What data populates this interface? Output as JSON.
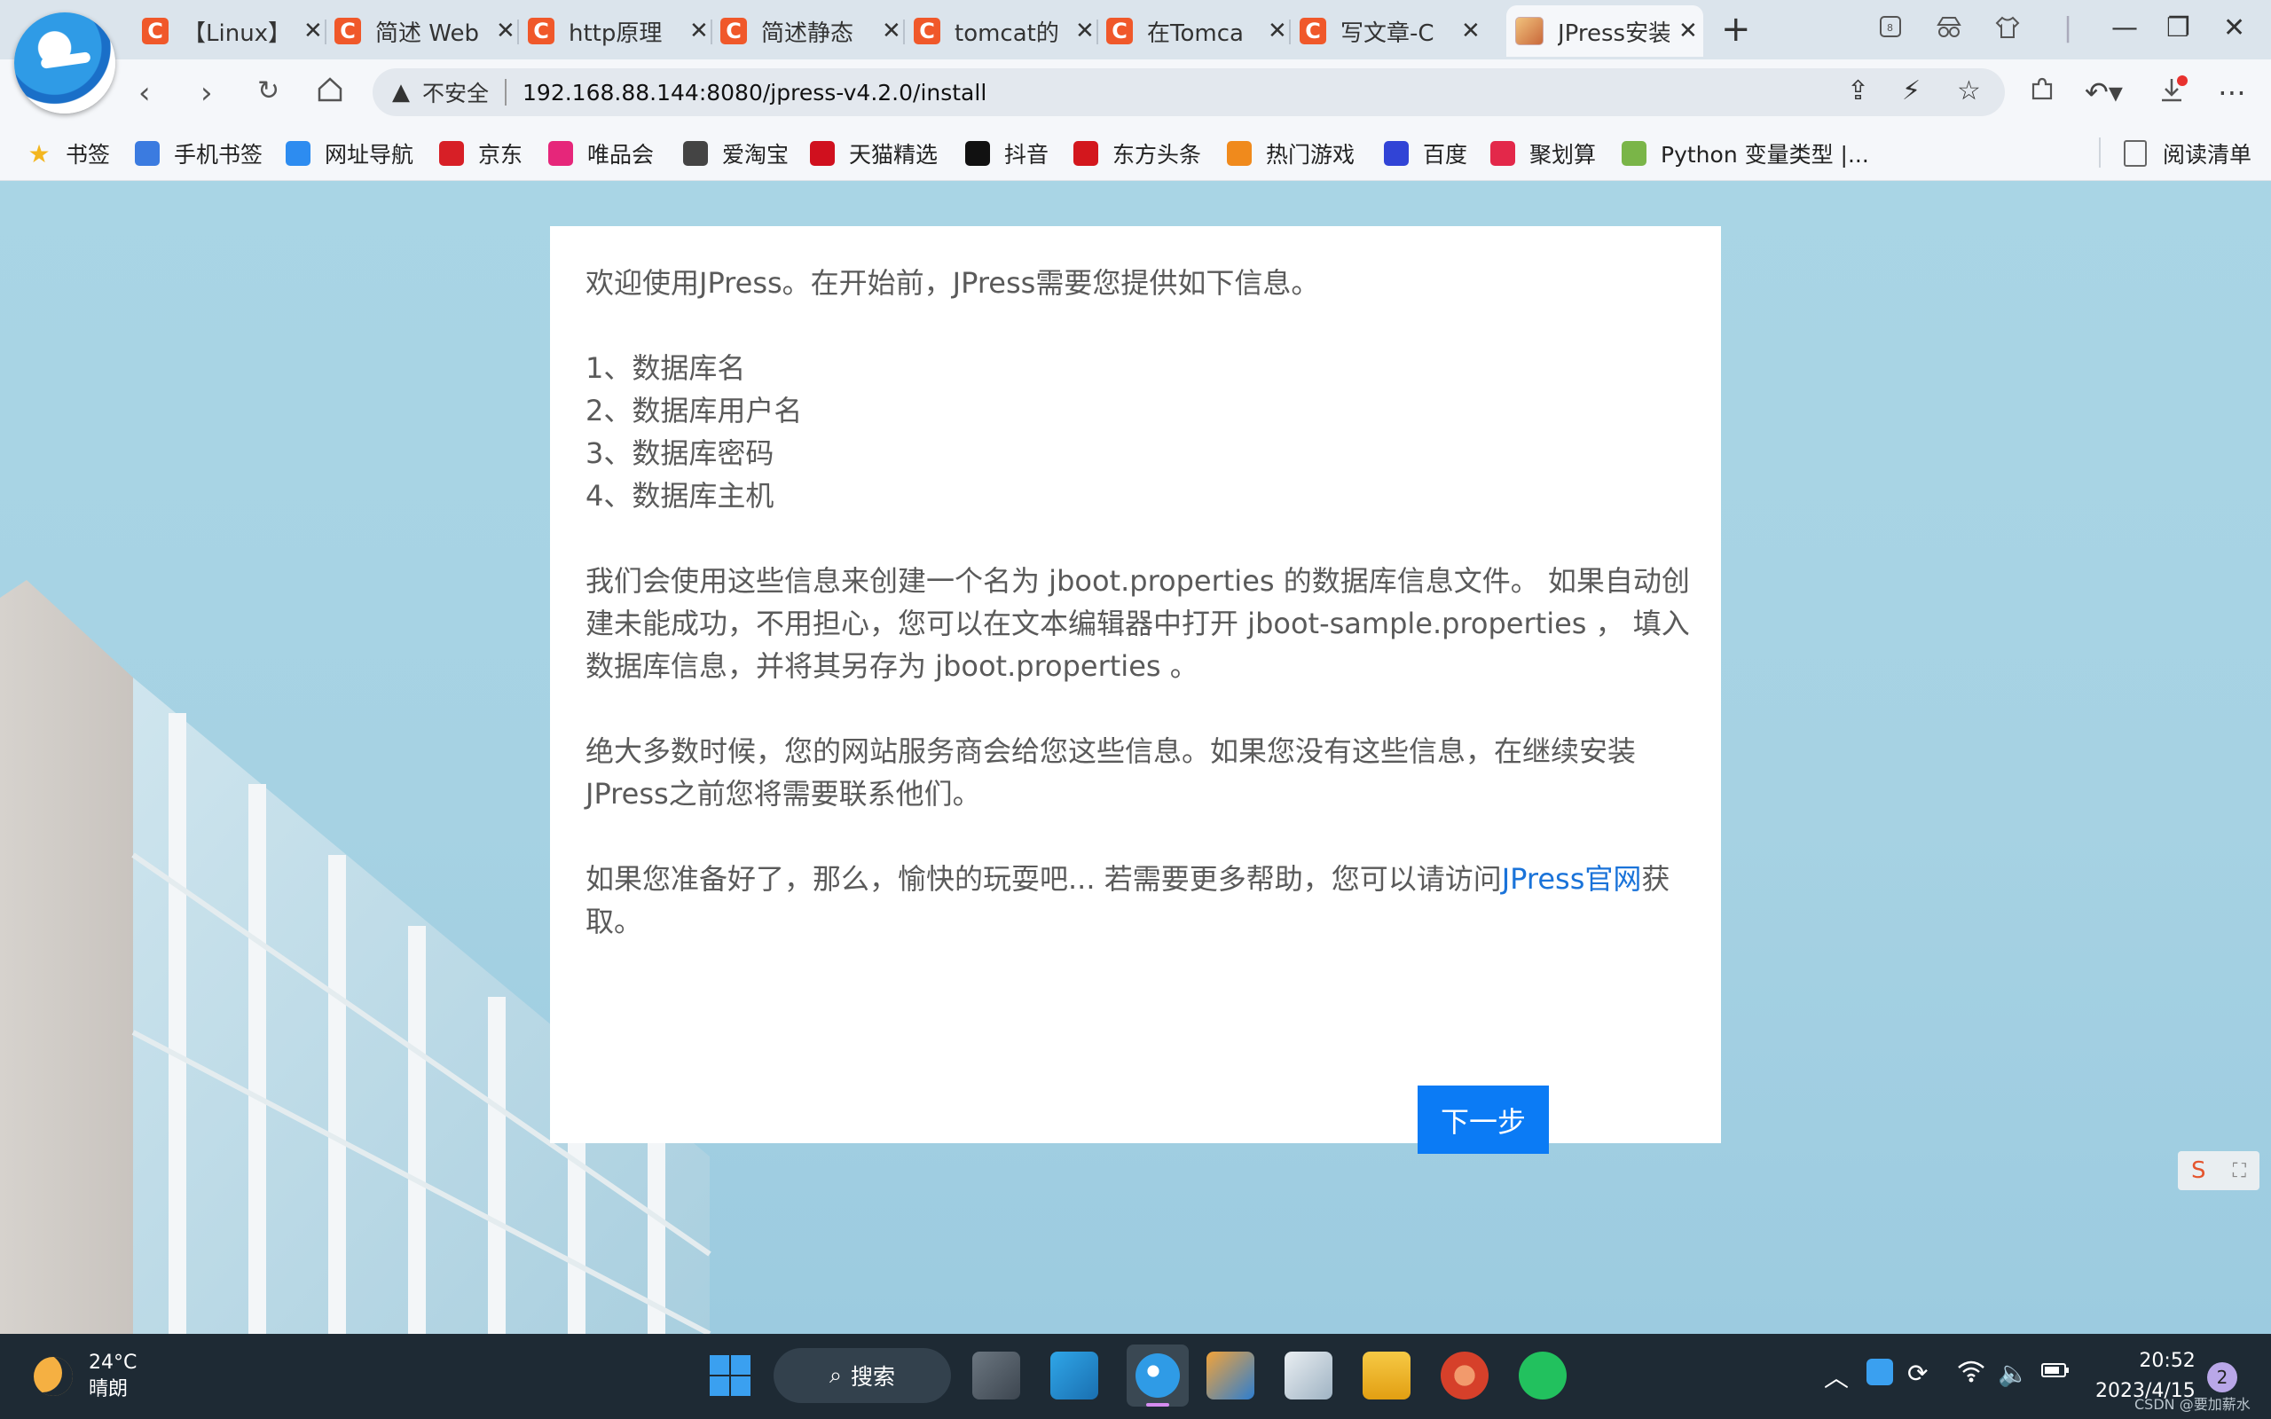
{
  "tabs": [
    {
      "label": "【Linux】",
      "favicon": "C"
    },
    {
      "label": "简述 Web",
      "favicon": "C"
    },
    {
      "label": "http原理",
      "favicon": "C"
    },
    {
      "label": "简述静态",
      "favicon": "C"
    },
    {
      "label": "tomcat的",
      "favicon": "C"
    },
    {
      "label": "在Tomca",
      "favicon": "C"
    },
    {
      "label": "写文章-C",
      "favicon": "C"
    },
    {
      "label": "JPress安装",
      "favicon": "icon",
      "active": true
    }
  ],
  "address_bar": {
    "security_label": "不安全",
    "url": "192.168.88.144:8080/jpress-v4.2.0/install"
  },
  "bookmarks": [
    {
      "label": "书签",
      "icon": "star-icon",
      "color": "#f3b61f"
    },
    {
      "label": "手机书签",
      "icon": "phone-icon",
      "color": "#3b7be0"
    },
    {
      "label": "网址导航",
      "icon": "compass-icon",
      "color": "#2d8cf0"
    },
    {
      "label": "京东",
      "icon": "jd-icon",
      "color": "#d71f26"
    },
    {
      "label": "唯品会",
      "icon": "vip-icon",
      "color": "#e6267a"
    },
    {
      "label": "爱淘宝",
      "icon": "taobao-icon",
      "color": "#444444"
    },
    {
      "label": "天猫精选",
      "icon": "tmall-icon",
      "color": "#d0101e"
    },
    {
      "label": "抖音",
      "icon": "douyin-icon",
      "color": "#111111"
    },
    {
      "label": "东方头条",
      "icon": "dongfang-icon",
      "color": "#d3171d"
    },
    {
      "label": "热门游戏",
      "icon": "game-icon",
      "color": "#f08a1c"
    },
    {
      "label": "百度",
      "icon": "baidu-icon",
      "color": "#3144d6"
    },
    {
      "label": "聚划算",
      "icon": "juhuasuan-icon",
      "color": "#e3284a"
    },
    {
      "label": "Python 变量类型 |...",
      "icon": "code-icon",
      "color": "#7ab548"
    }
  ],
  "reading_list": "阅读清单",
  "install": {
    "intro": "欢迎使用JPress。在开始前，JPress需要您提供如下信息。",
    "items": [
      "1、数据库名",
      "2、数据库用户名",
      "3、数据库密码",
      "4、数据库主机"
    ],
    "para1": "我们会使用这些信息来创建一个名为 jboot.properties 的数据库信息文件。 如果自动创建未能成功，不用担心，您可以在文本编辑器中打开 jboot-sample.properties ， 填入数据库信息，并将其另存为 jboot.properties 。",
    "para2": "绝大多数时候，您的网站服务商会给您这些信息。如果您没有这些信息，在继续安装JPress之前您将需要联系他们。",
    "para3_before": "如果您准备好了，那么，愉快的玩耍吧... 若需要更多帮助，您可以请访问",
    "para3_link": "JPress官网",
    "para3_after": "获取。",
    "next_button": "下一步"
  },
  "taskbar": {
    "weather_temp": "24°C",
    "weather_desc": "晴朗",
    "search_label": "搜索",
    "time": "20:52",
    "date": "2023/4/15",
    "notification_count": "2",
    "watermark": "CSDN @要加薪水"
  },
  "colors": {
    "accent": "#0b7bf5",
    "link": "#1a73d9",
    "tab_favicon": "#f0582a",
    "taskbar": "#1e2a34"
  }
}
